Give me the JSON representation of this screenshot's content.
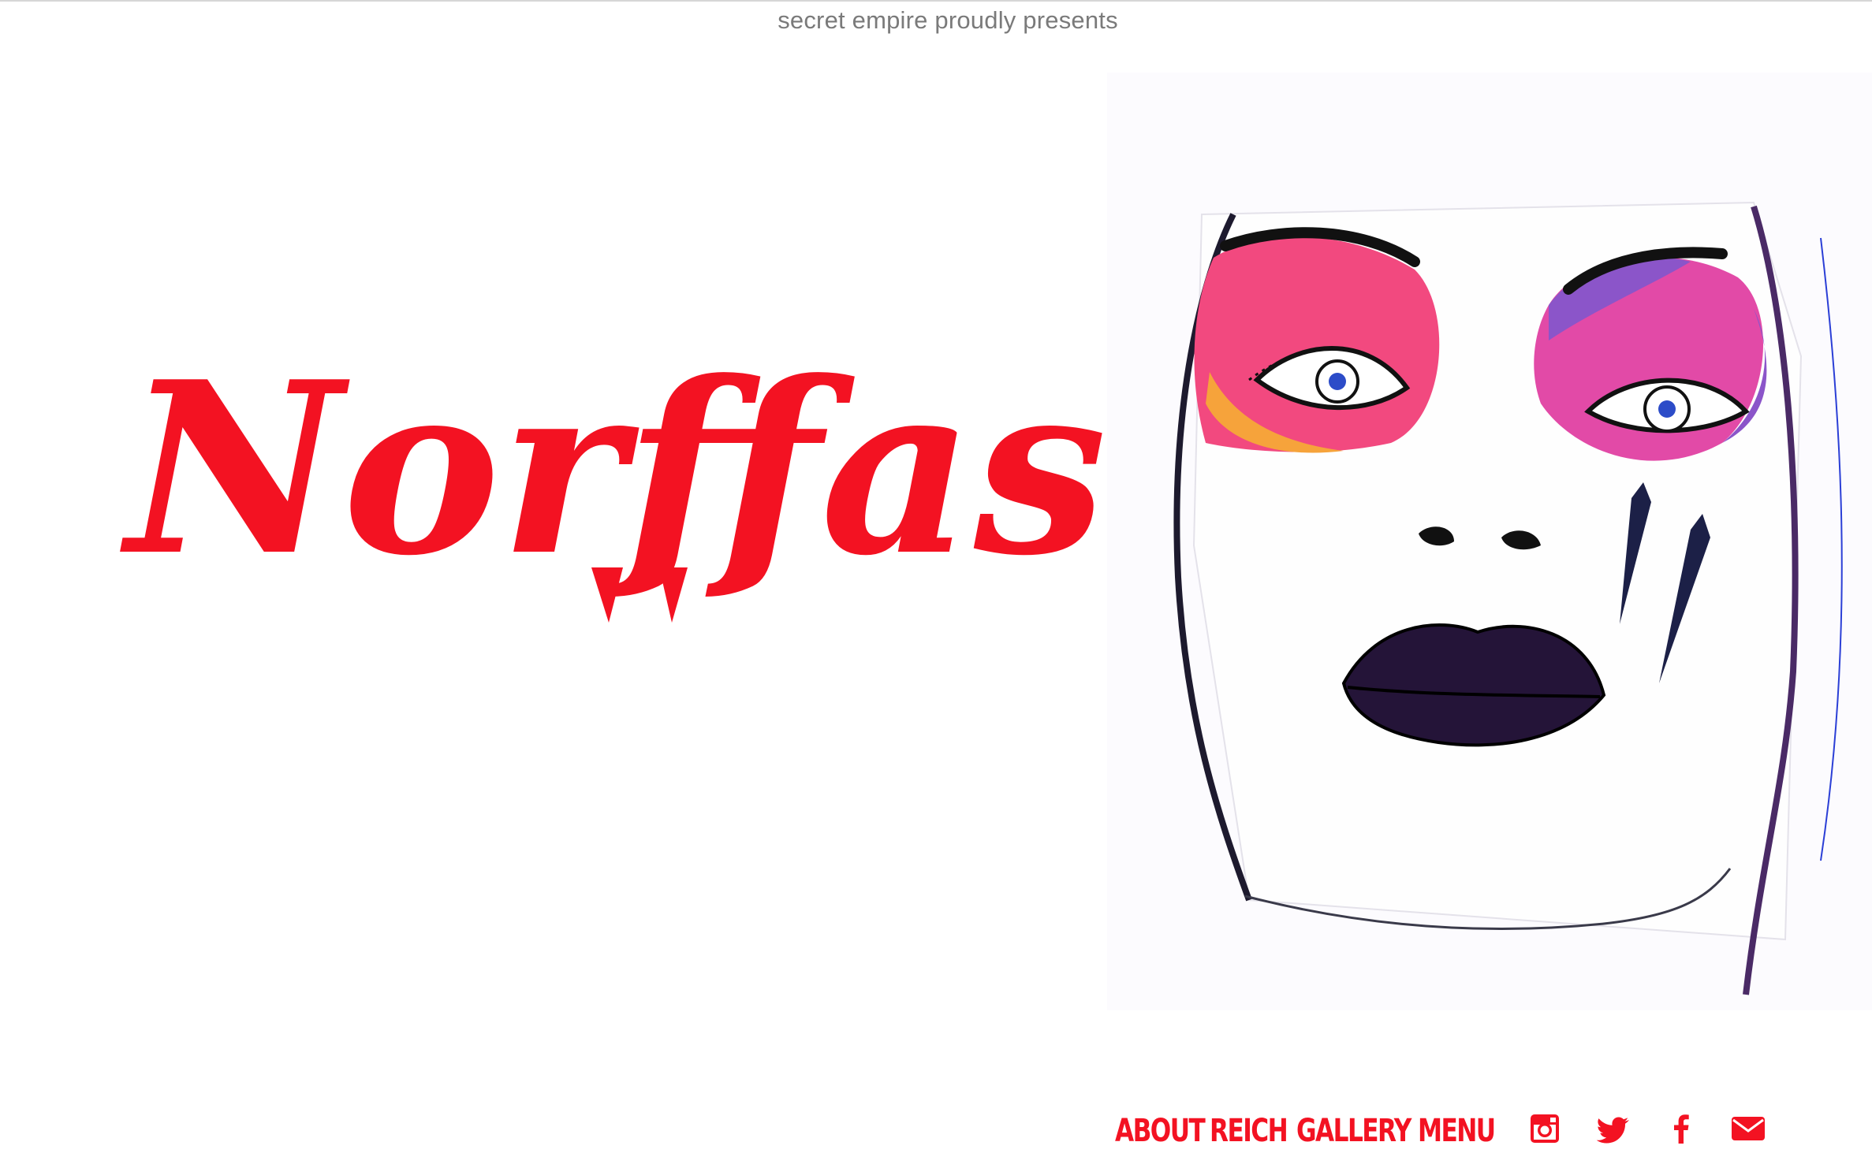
{
  "header": {
    "tagline": "secret empire proudly presents"
  },
  "brand": {
    "logo_text": "Norffas",
    "color": "#f31222"
  },
  "artwork": {
    "subject": "face-makeup-illustration"
  },
  "nav": {
    "items": [
      {
        "label": "ABOUT"
      },
      {
        "label": "REICH"
      },
      {
        "label": "GALLERY"
      },
      {
        "label": "MENU"
      }
    ]
  },
  "social": {
    "icons": [
      "instagram-icon",
      "twitter-icon",
      "facebook-icon",
      "email-icon"
    ]
  },
  "colors": {
    "accent": "#f31222",
    "tagline": "#7a7a7a",
    "background": "#ffffff"
  }
}
